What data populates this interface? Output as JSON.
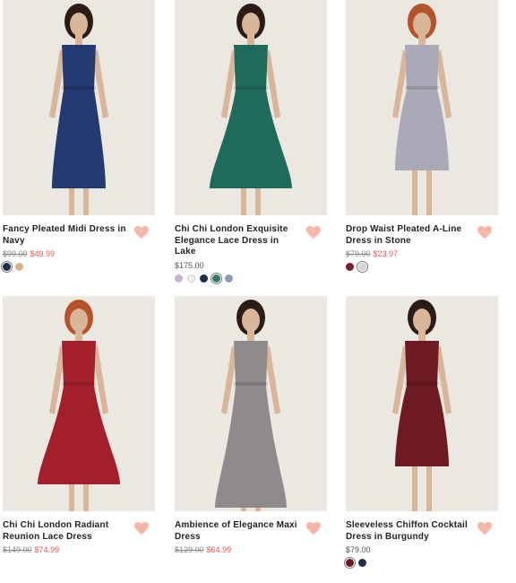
{
  "products": [
    {
      "title": "Fancy Pleated Midi Dress in Navy",
      "old_price": "$99.00",
      "price": "$49.99",
      "dress_color": "#243a70",
      "swatches": [
        "#1f2d4f",
        "#d7b48c"
      ],
      "selected_swatch": 0
    },
    {
      "title": "Chi Chi London Exquisite Elegance Lace Dress in Lake",
      "old_price": "",
      "price": "$175.00",
      "dress_color": "#1e6b5c",
      "swatches": [
        "#c7b2cf",
        "#f1f1f1",
        "#1f2d4f",
        "#2f7d6b",
        "#8d9ab3"
      ],
      "selected_swatch": 3
    },
    {
      "title": "Drop Waist Pleated A-Line Dress in Stone",
      "old_price": "$79.00",
      "price": "$23.97",
      "dress_color": "#a9a9b8",
      "swatches": [
        "#7a1f2b",
        "#d6d6d6"
      ],
      "selected_swatch": 1
    },
    {
      "title": "Chi Chi London Radiant Reunion Lace Dress",
      "old_price": "$149.00",
      "price": "$74.99",
      "dress_color": "#a41f2c",
      "swatches": [],
      "selected_swatch": -1
    },
    {
      "title": "Ambience of Elegance Maxi Dress",
      "old_price": "$129.00",
      "price": "$64.99",
      "dress_color": "#8f8a8c",
      "swatches": [],
      "selected_swatch": -1
    },
    {
      "title": "Sleeveless Chiffon Cocktail Dress in Burgundy",
      "old_price": "",
      "price": "$79.00",
      "dress_color": "#6e1a22",
      "swatches": [
        "#6e1a22",
        "#1f2d4f"
      ],
      "selected_swatch": 0
    }
  ],
  "colors": {
    "heart": "#f6b7a7",
    "sale_price": "#e15a55",
    "photo_background": "#ebe7e1"
  },
  "icons": {
    "favorite": "heart-icon"
  }
}
